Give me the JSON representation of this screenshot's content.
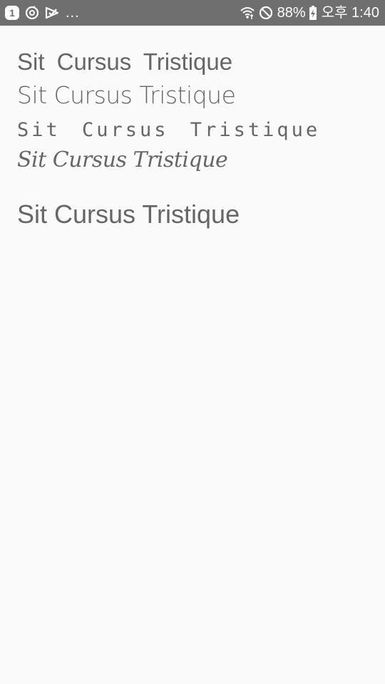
{
  "status_bar": {
    "notification_badge": "1",
    "overflow_dots": "...",
    "battery_percent": "88%",
    "time": "오후 1:40",
    "background_color": "#6f6f6f",
    "icons": [
      "notification-one-icon",
      "sync-icon",
      "download-check-icon",
      "wifi-icon",
      "do-not-disturb-icon",
      "battery-charging-icon"
    ]
  },
  "samples": [
    "Sit Cursus Tristique",
    "Sit Cursus Tristique",
    "Sit Cursus Tristique",
    "Sit Cursus Tristique",
    "Sit Cursus Tristique"
  ],
  "colors": {
    "text": "#666666",
    "background": "#fafafa"
  }
}
